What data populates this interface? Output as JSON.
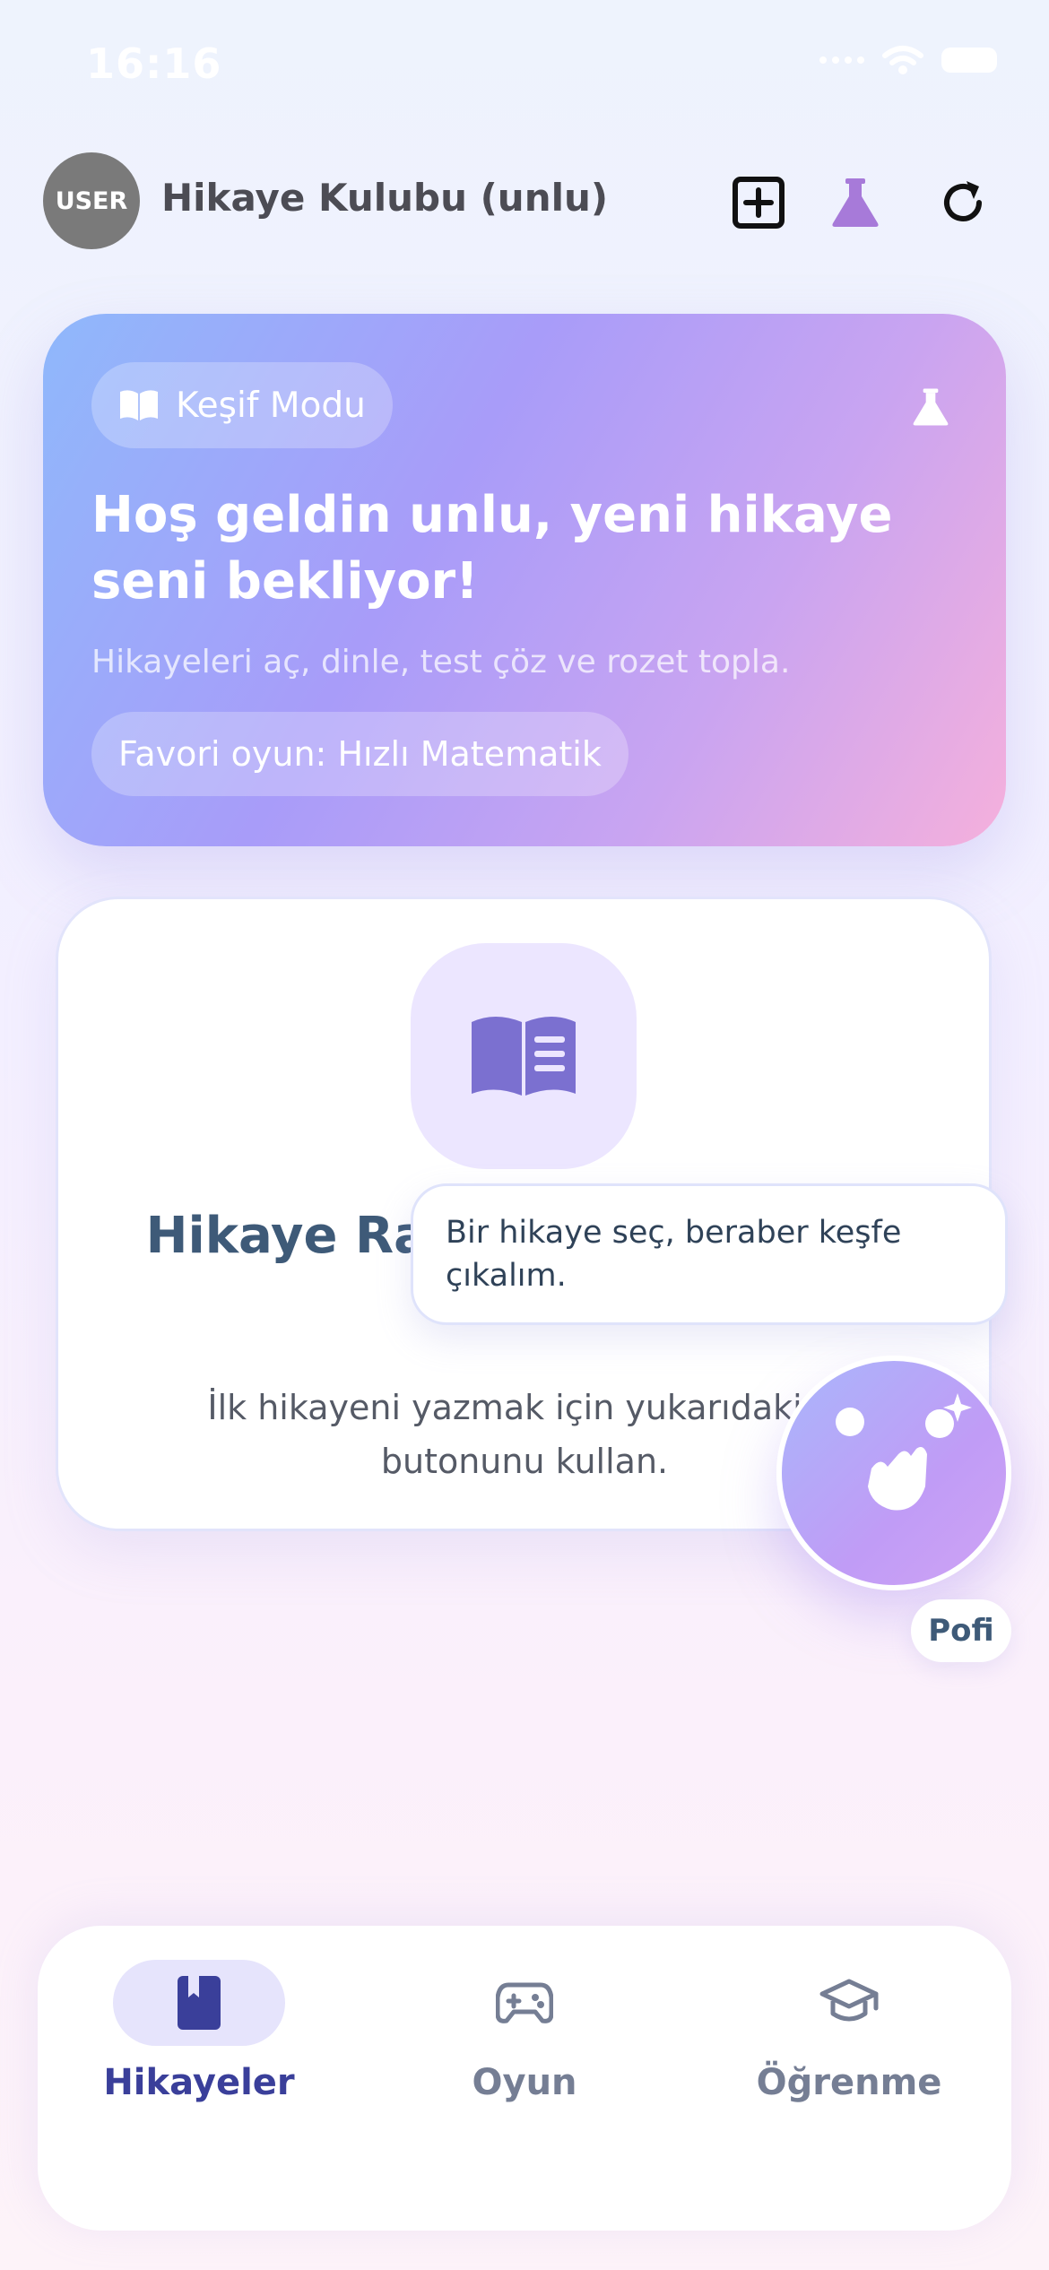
{
  "status": {
    "time": "16:16"
  },
  "header": {
    "avatar_text": "USER",
    "title": "Hikaye Kulubu (unlu)",
    "icons": [
      "plus-square-icon",
      "flask-icon",
      "refresh-icon"
    ]
  },
  "hero": {
    "chip_label": "Keşif Modu",
    "title": "Hoş geldin unlu, yeni hikaye seni bekliyor!",
    "subtitle": "Hikayeleri aç, dinle, test çöz ve rozet topla.",
    "favorite": "Favori oyun: Hızlı Matematik"
  },
  "empty_state": {
    "title": "Hikaye Rafın Henüz Boşluk Var",
    "description": "İlk hikayeni yazmak için yukarıdaki + butonunu kullan."
  },
  "mascot": {
    "tooltip": "Bir hikaye seç, beraber keşfe çıkalım.",
    "name": "Pofi"
  },
  "nav": {
    "items": [
      {
        "label": "Hikayeler",
        "icon": "bookmark-book-icon",
        "active": true
      },
      {
        "label": "Oyun",
        "icon": "gamepad-icon",
        "active": false
      },
      {
        "label": "Öğrenme",
        "icon": "graduation-cap-icon",
        "active": false
      }
    ]
  },
  "colors": {
    "accent": "#a89cf9",
    "nav_active": "#3a3f9a",
    "book_icon": "#7b70d0"
  }
}
